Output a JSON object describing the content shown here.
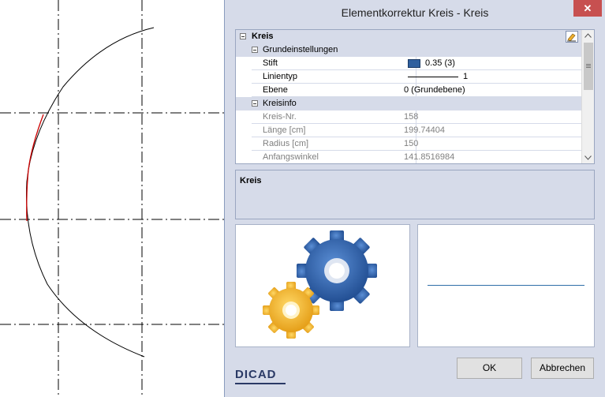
{
  "dialog": {
    "title": "Elementkorrektur Kreis - Kreis",
    "close_label": "✕",
    "root_label": "Kreis",
    "sections": [
      {
        "label": "Grundeinstellungen"
      },
      {
        "label": "Kreisinfo"
      }
    ],
    "properties": [
      {
        "name": "Stift",
        "value": "0.35 (3)"
      },
      {
        "name": "Linientyp",
        "value": "1"
      },
      {
        "name": "Ebene",
        "value": "0 (Grundebene)"
      },
      {
        "name": "Kreis-Nr.",
        "value": "158"
      },
      {
        "name": "Länge [cm]",
        "value": "199.74404"
      },
      {
        "name": "Radius [cm]",
        "value": "150"
      },
      {
        "name": "Anfangswinkel",
        "value": "141.8516984"
      }
    ],
    "description_title": "Kreis",
    "ok_label": "OK",
    "cancel_label": "Abbrechen",
    "logo_text": "DICAD"
  },
  "colors": {
    "pen_swatch": "#2f5f9e",
    "arc_highlight": "#cc0000",
    "preview_line": "#2f6fa8",
    "gear_blue": "#2e5fae",
    "gear_yellow": "#f3b62a"
  },
  "icons": [
    "minus-icon",
    "edit-icon",
    "close-icon",
    "gear-icon",
    "scroll-up-icon",
    "scroll-down-icon"
  ]
}
